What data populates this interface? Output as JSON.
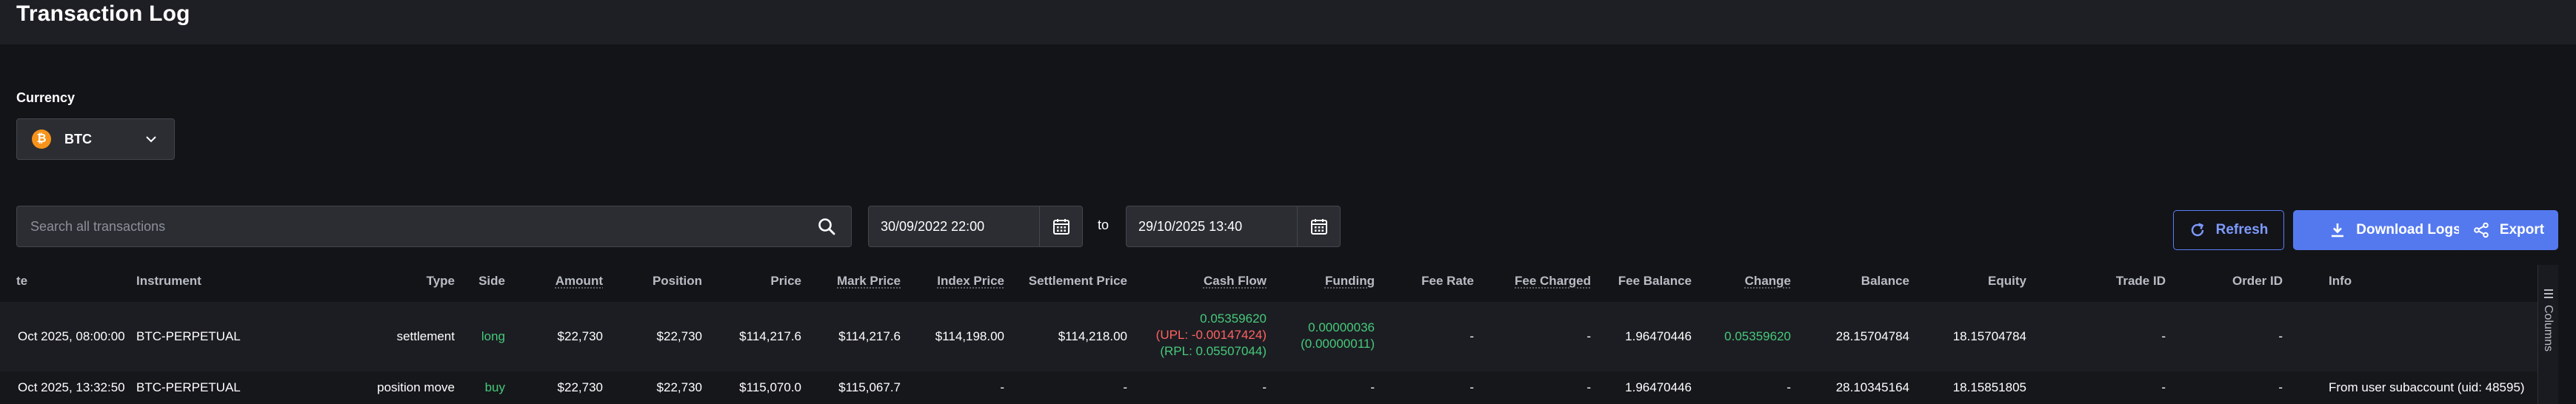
{
  "page": {
    "title": "Transaction Log"
  },
  "currency": {
    "label": "Currency",
    "value": "BTC",
    "icon": "bitcoin-icon",
    "coin_glyph": "₿"
  },
  "search": {
    "placeholder": "Search all transactions",
    "value": ""
  },
  "date_range": {
    "from": "30/09/2022 22:00",
    "to_label": "to",
    "to": "29/10/2025 13:40"
  },
  "actions": {
    "refresh": "Refresh",
    "download": "Download Logs",
    "export": "Export"
  },
  "table": {
    "columns": {
      "date": "te",
      "instrument": "Instrument",
      "type": "Type",
      "side": "Side",
      "amount": "Amount",
      "position": "Position",
      "price": "Price",
      "mark_price": "Mark Price",
      "index_price": "Index Price",
      "settlement_price": "Settlement Price",
      "cash_flow": "Cash Flow",
      "funding": "Funding",
      "fee_rate": "Fee Rate",
      "fee_charged": "Fee Charged",
      "fee_balance": "Fee Balance",
      "change": "Change",
      "balance": "Balance",
      "equity": "Equity",
      "trade_id": "Trade ID",
      "order_id": "Order ID",
      "info": "Info"
    },
    "rows": [
      {
        "date": "Oct 2025, 08:00:00",
        "instrument": "BTC-PERPETUAL",
        "type": "settlement",
        "side": "long",
        "amount": "$22,730",
        "position": "$22,730",
        "price": "$114,217.6",
        "mark_price": "$114,217.6",
        "index_price": "$114,198.00",
        "settlement_price": "$114,218.00",
        "cash_flow": "0.05359620",
        "cash_flow_upl": "(UPL: -0.00147424)",
        "cash_flow_rpl": "(RPL: 0.05507044)",
        "funding": "0.00000036",
        "funding_sub": "(0.00000011)",
        "fee_rate": "-",
        "fee_charged": "-",
        "fee_balance": "1.96470446",
        "change": "0.05359620",
        "balance": "28.15704784",
        "equity": "18.15704784",
        "trade_id": "-",
        "order_id": "-",
        "info": ""
      },
      {
        "date": "Oct 2025, 13:32:50",
        "instrument": "BTC-PERPETUAL",
        "type": "position move",
        "side": "buy",
        "amount": "$22,730",
        "position": "$22,730",
        "price": "$115,070.0",
        "mark_price": "$115,067.7",
        "index_price": "-",
        "settlement_price": "-",
        "cash_flow": "-",
        "funding": "-",
        "fee_rate": "-",
        "fee_charged": "-",
        "fee_balance": "1.96470446",
        "change": "-",
        "balance": "28.10345164",
        "equity": "18.15851805",
        "trade_id": "-",
        "order_id": "-",
        "info": "From user subaccount (uid: 48595)"
      }
    ]
  },
  "columns_tab": {
    "label": "Columns"
  },
  "colors": {
    "background": "#131418",
    "header_bar": "#1e1f24",
    "accent": "#5479ef",
    "positive": "#46c97b",
    "negative": "#ff6161",
    "bitcoin": "#f7931a"
  }
}
